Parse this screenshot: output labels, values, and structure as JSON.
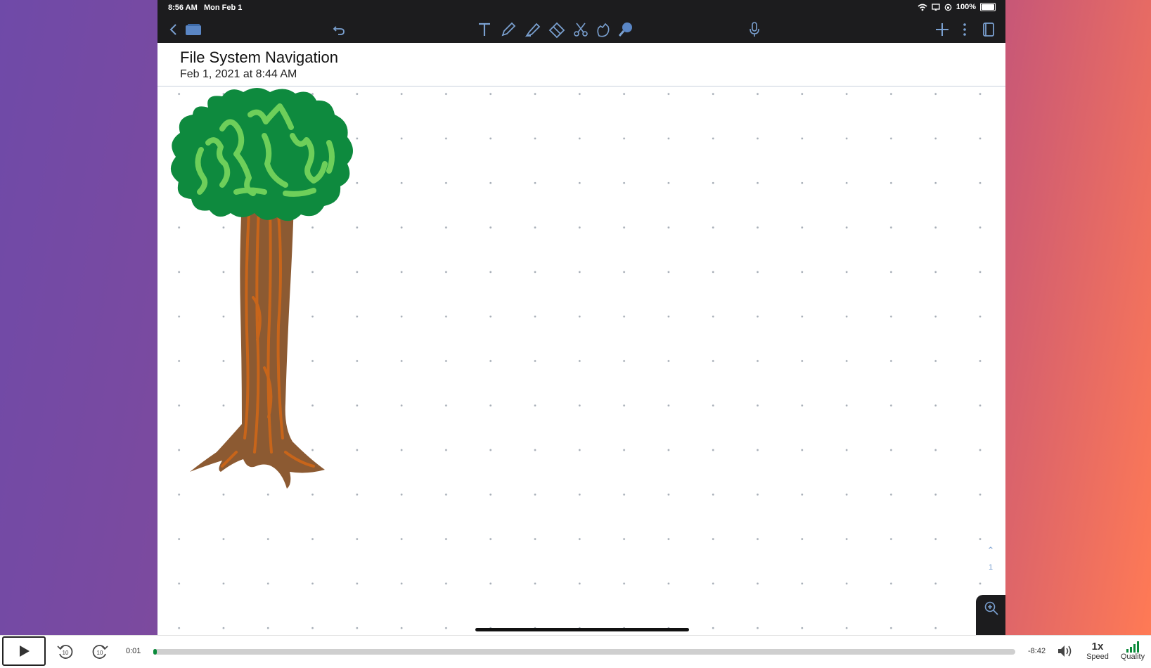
{
  "status_bar": {
    "time": "8:56 AM",
    "date": "Mon Feb 1",
    "battery": "100%"
  },
  "toolbar": {
    "icons": [
      "back-icon",
      "notebooks-icon",
      "undo-icon",
      "text-tool-icon",
      "pencil-icon",
      "highlighter-icon",
      "eraser-icon",
      "scissors-icon",
      "hand-icon",
      "pointer-icon",
      "microphone-icon",
      "add-icon",
      "more-icon",
      "pages-icon"
    ]
  },
  "document": {
    "title": "File System Navigation",
    "date": "Feb 1, 2021 at 8:44 AM"
  },
  "page_indicator": {
    "current": "1"
  },
  "player": {
    "elapsed": "0:01",
    "remaining": "-8:42",
    "progress": 0.003,
    "speed_value": "1x",
    "speed_label": "Speed",
    "quality_label": "Quality",
    "skip_back": "10",
    "skip_forward": "10"
  },
  "colors": {
    "accent_green": "#0a8a3a",
    "toolbar_bg": "#1c1c1e",
    "tool_icon_blue": "#7aa0d0"
  }
}
